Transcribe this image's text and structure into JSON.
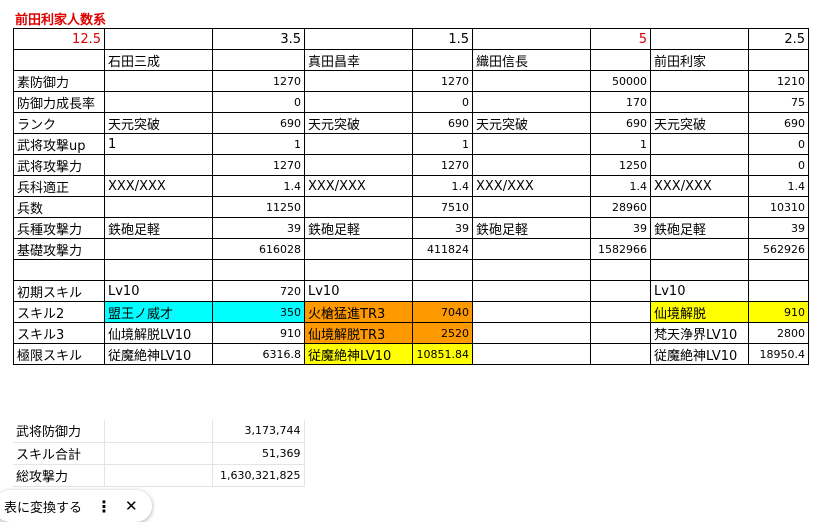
{
  "title": "前田利家人数系",
  "header_row": [
    "12.5",
    "",
    "3.5",
    "",
    "1.5",
    "",
    "5",
    "",
    "2.5"
  ],
  "names_row": [
    "",
    "石田三成",
    "",
    "真田昌幸",
    "",
    "織田信長",
    "",
    "前田利家",
    ""
  ],
  "rows": [
    [
      "素防御力",
      "",
      "1270",
      "",
      "1270",
      "",
      "50000",
      "",
      "1210"
    ],
    [
      "防御力成長率",
      "",
      "0",
      "",
      "0",
      "",
      "170",
      "",
      "75"
    ],
    [
      "ランク",
      "天元突破",
      "690",
      "天元突破",
      "690",
      "天元突破",
      "690",
      "天元突破",
      "690"
    ],
    [
      "武将攻撃up",
      "1",
      "1",
      "",
      "1",
      "",
      "1",
      "",
      "0"
    ],
    [
      "武将攻撃力",
      "",
      "1270",
      "",
      "1270",
      "",
      "1250",
      "",
      "0"
    ],
    [
      "兵科適正",
      "XXX/XXX",
      "1.4",
      "XXX/XXX",
      "1.4",
      "XXX/XXX",
      "1.4",
      "XXX/XXX",
      "1.4"
    ],
    [
      "兵数",
      "",
      "11250",
      "",
      "7510",
      "",
      "28960",
      "",
      "10310"
    ],
    [
      "兵種攻撃力",
      "鉄砲足軽",
      "39",
      "鉄砲足軽",
      "39",
      "鉄砲足軽",
      "39",
      "鉄砲足軽",
      "39"
    ],
    [
      "基礎攻撃力",
      "",
      "616028",
      "",
      "411824",
      "",
      "1582966",
      "",
      "562926"
    ]
  ],
  "skill_rows": [
    [
      "初期スキル",
      "Lv10",
      "720",
      "Lv10",
      "",
      "",
      "",
      "Lv10",
      ""
    ],
    [
      "スキル2",
      "盟王ノ威才",
      "350",
      "火槍猛進TR3",
      "7040",
      "",
      "",
      "仙境解脱",
      "910"
    ],
    [
      "スキル3",
      "仙境解脱LV10",
      "910",
      "仙境解脱TR3",
      "2520",
      "",
      "",
      "梵天浄界LV10",
      "2800"
    ],
    [
      "極限スキル",
      "従魔絶神LV10",
      "6316.8",
      "従魔絶神LV10",
      "10851.84",
      "",
      "",
      "従魔絶神LV10",
      "18950.4"
    ]
  ],
  "summary": [
    {
      "label": "武将防御力",
      "value": "3,173,744"
    },
    {
      "label": "スキル合計",
      "value": "51,369"
    },
    {
      "label": "総攻撃力",
      "value": "1,630,321,825"
    }
  ],
  "chip": {
    "label": "表に変換する",
    "more_icon": "more-vert-icon",
    "close_icon": "close-icon"
  },
  "colors": {
    "title": "#e00000",
    "cyan": "#00ffff",
    "orange": "#ff9900",
    "yellow": "#ffff00"
  }
}
